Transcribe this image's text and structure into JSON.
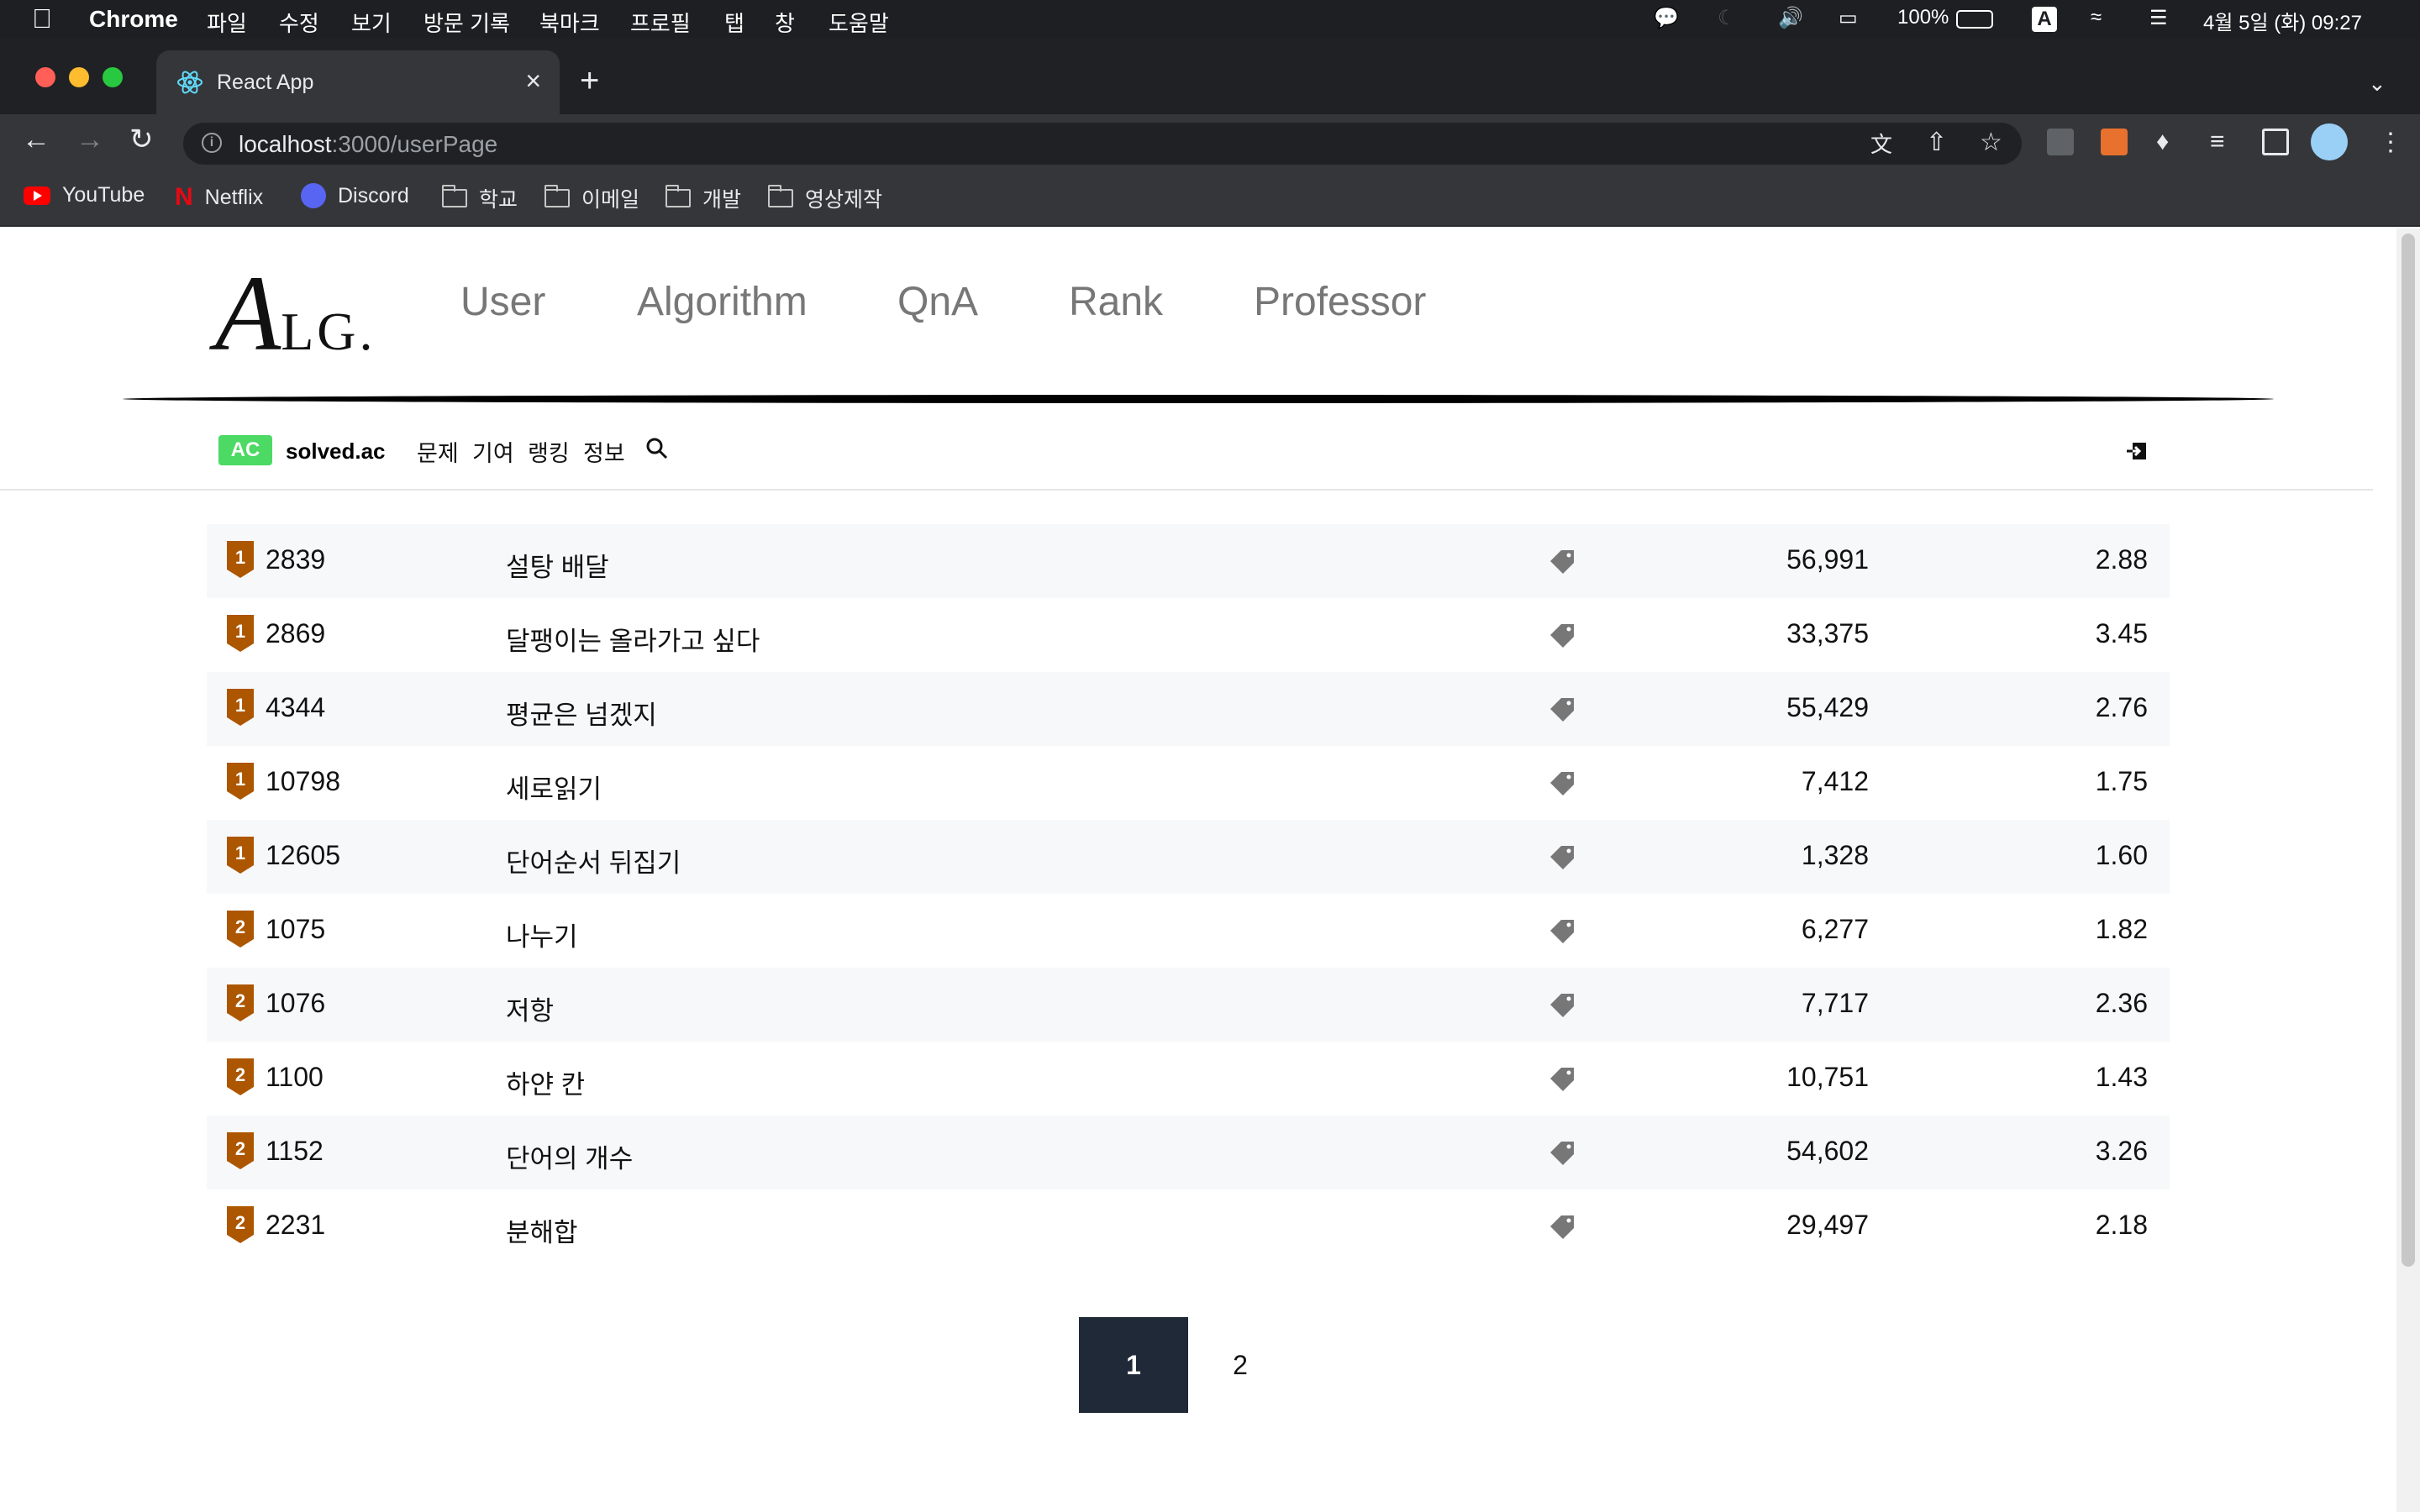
{
  "menubar": {
    "app": "Chrome",
    "items": [
      "파일",
      "수정",
      "보기",
      "방문 기록",
      "북마크",
      "프로필",
      "탭",
      "창",
      "도움말"
    ],
    "battery": "100%",
    "input_source": "A",
    "datetime": "4월 5일 (화) 09:27"
  },
  "browser": {
    "tab_title": "React App",
    "url_host": "localhost",
    "url_path": ":3000/userPage",
    "bookmarks": [
      "YouTube",
      "Netflix",
      "Discord",
      "학교",
      "이메일",
      "개발",
      "영상제작"
    ]
  },
  "site": {
    "logo_big": "A",
    "logo_small": "LG.",
    "nav": [
      "User",
      "Algorithm",
      "QnA",
      "Rank",
      "Professor"
    ]
  },
  "solvedac": {
    "badge": "AC",
    "name": "solved.ac",
    "menu": [
      "문제",
      "기여",
      "랭킹",
      "정보"
    ]
  },
  "problems": {
    "tier_colors": {
      "bronze": "#ad5600"
    },
    "rows": [
      {
        "tier": "1",
        "id": "2839",
        "title": "설탕 배달",
        "solved": "56,991",
        "avg": "2.88"
      },
      {
        "tier": "1",
        "id": "2869",
        "title": "달팽이는 올라가고 싶다",
        "solved": "33,375",
        "avg": "3.45"
      },
      {
        "tier": "1",
        "id": "4344",
        "title": "평균은 넘겠지",
        "solved": "55,429",
        "avg": "2.76"
      },
      {
        "tier": "1",
        "id": "10798",
        "title": "세로읽기",
        "solved": "7,412",
        "avg": "1.75"
      },
      {
        "tier": "1",
        "id": "12605",
        "title": "단어순서 뒤집기",
        "solved": "1,328",
        "avg": "1.60"
      },
      {
        "tier": "2",
        "id": "1075",
        "title": "나누기",
        "solved": "6,277",
        "avg": "1.82"
      },
      {
        "tier": "2",
        "id": "1076",
        "title": "저항",
        "solved": "7,717",
        "avg": "2.36"
      },
      {
        "tier": "2",
        "id": "1100",
        "title": "하얀 칸",
        "solved": "10,751",
        "avg": "1.43"
      },
      {
        "tier": "2",
        "id": "1152",
        "title": "단어의 개수",
        "solved": "54,602",
        "avg": "3.26"
      },
      {
        "tier": "2",
        "id": "2231",
        "title": "분해합",
        "solved": "29,497",
        "avg": "2.18"
      }
    ]
  },
  "pagination": {
    "pages": [
      "1",
      "2"
    ],
    "current": "1"
  }
}
